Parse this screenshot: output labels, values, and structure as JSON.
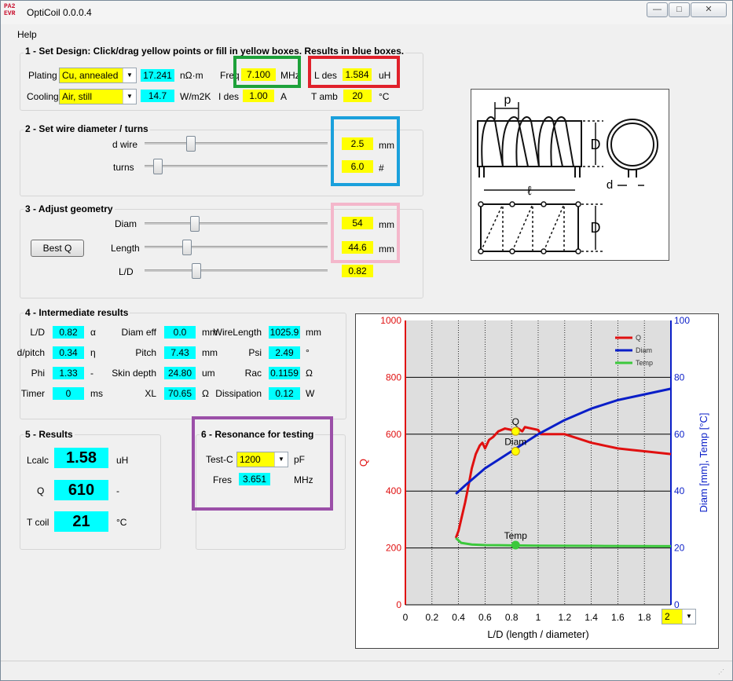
{
  "window": {
    "title": "OptiCoil 0.0.0.4",
    "logo_text": "PA2\nEVR",
    "menu": [
      "Help"
    ]
  },
  "section1": {
    "title": "1 - Set Design: Click/drag yellow points or fill in yellow boxes. Results in blue boxes.",
    "plating_label": "Plating",
    "plating_value": "Cu, annealed",
    "resistivity_value": "17.241",
    "resistivity_unit": "nΩ·m",
    "freq_label": "Freq",
    "freq_value": "7.100",
    "freq_unit": "MHz",
    "ldes_label": "L des",
    "ldes_value": "1.584",
    "ldes_unit": "uH",
    "cooling_label": "Cooling",
    "cooling_value": "Air, still",
    "htc_value": "14.7",
    "htc_unit": "W/m2K",
    "ides_label": "I des",
    "ides_value": "1.00",
    "ides_unit": "A",
    "tamb_label": "T amb",
    "tamb_value": "20",
    "tamb_unit": "°C"
  },
  "section2": {
    "title": "2 - Set wire diameter / turns",
    "dwire_label": "d wire",
    "dwire_value": "2.5",
    "dwire_unit": "mm",
    "dwire_slider": 0.25,
    "turns_label": "turns",
    "turns_value": "6.0",
    "turns_unit": "#",
    "turns_slider": 0.05
  },
  "section3": {
    "title": "3 - Adjust geometry",
    "best_q_label": "Best Q",
    "diam_label": "Diam",
    "diam_value": "54",
    "diam_unit": "mm",
    "diam_slider": 0.27,
    "length_label": "Length",
    "length_value": "44.6",
    "length_unit": "mm",
    "length_slider": 0.23,
    "ld_label": "L/D",
    "ld_value": "0.82",
    "ld_slider": 0.28
  },
  "section4": {
    "title": "4 - Intermediate results",
    "rows": [
      [
        {
          "label": "L/D",
          "value": "0.82",
          "unit": "α"
        },
        {
          "label": "Diam eff",
          "value": "0.0",
          "unit": "mm"
        },
        {
          "label": "WireLength",
          "value": "1025.9",
          "unit": "mm"
        }
      ],
      [
        {
          "label": "d/pitch",
          "value": "0.34",
          "unit": "η"
        },
        {
          "label": "Pitch",
          "value": "7.43",
          "unit": "mm"
        },
        {
          "label": "Psi",
          "value": "2.49",
          "unit": "°"
        }
      ],
      [
        {
          "label": "Phi",
          "value": "1.33",
          "unit": "-"
        },
        {
          "label": "Skin depth",
          "value": "24.80",
          "unit": "um"
        },
        {
          "label": "Rac",
          "value": "0.1159",
          "unit": "Ω"
        }
      ],
      [
        {
          "label": "Timer",
          "value": "0",
          "unit": "ms"
        },
        {
          "label": "XL",
          "value": "70.65",
          "unit": "Ω"
        },
        {
          "label": "Dissipation",
          "value": "0.12",
          "unit": "W"
        }
      ]
    ]
  },
  "section5": {
    "title": "5 - Results",
    "lcalc_label": "Lcalc",
    "lcalc_value": "1.58",
    "lcalc_unit": "uH",
    "q_label": "Q",
    "q_value": "610",
    "q_unit": "-",
    "tcoil_label": "T coil",
    "tcoil_value": "21",
    "tcoil_unit": "°C"
  },
  "section6": {
    "title": "6 - Resonance for testing",
    "testc_label": "Test-C",
    "testc_value": "1200",
    "testc_unit": "pF",
    "fres_label": "Fres",
    "fres_value": "3.651",
    "fres_unit": "MHz"
  },
  "diagram": {
    "p_label": "p",
    "D_label": "D",
    "l_label": "ℓ",
    "d_label": "d"
  },
  "highlight_colors": {
    "freq": "#1da13a",
    "ldes": "#e0202a",
    "wire": "#1aa0dc",
    "geometry": "#f4b7cb",
    "resonance": "#9b4fa8"
  },
  "chart_data": {
    "type": "line",
    "xlabel": "L/D (length / diameter)",
    "ylabel": "Q",
    "ylabel_right": "Diam [mm], Temp [°C]",
    "xlim": [
      0,
      2
    ],
    "ylim": [
      0,
      1000
    ],
    "ylim_right": [
      0,
      100
    ],
    "x_ticks": [
      "0",
      "0.2",
      "0.4",
      "0.6",
      "0.8",
      "1",
      "1.2",
      "1.4",
      "1.6",
      "1.8"
    ],
    "y_ticks": [
      "0",
      "200",
      "400",
      "600",
      "800",
      "1000"
    ],
    "y_ticks_right": [
      "0",
      "20",
      "40",
      "60",
      "80",
      "100"
    ],
    "xmax_selector": "2",
    "legend_position": "top-right",
    "grid": true,
    "series": [
      {
        "name": "Q",
        "axis": "left",
        "color": "#e01010",
        "x": [
          0.38,
          0.4,
          0.42,
          0.45,
          0.48,
          0.5,
          0.53,
          0.56,
          0.58,
          0.6,
          0.63,
          0.66,
          0.7,
          0.75,
          0.8,
          0.85,
          0.88,
          0.9,
          0.95,
          1.0,
          1.02,
          1.1,
          1.2,
          1.3,
          1.4,
          1.5,
          1.6,
          1.7,
          1.8,
          2.0
        ],
        "y": [
          235,
          260,
          300,
          360,
          430,
          480,
          530,
          560,
          570,
          550,
          580,
          590,
          610,
          620,
          615,
          620,
          610,
          625,
          620,
          615,
          600,
          600,
          600,
          585,
          570,
          560,
          550,
          545,
          540,
          530
        ]
      },
      {
        "name": "Diam",
        "axis": "right",
        "color": "#0a1ec8",
        "x": [
          0.38,
          0.45,
          0.5,
          0.6,
          0.7,
          0.8,
          0.9,
          1.0,
          1.2,
          1.4,
          1.6,
          1.8,
          2.0
        ],
        "y": [
          39,
          42,
          44,
          48,
          51,
          54,
          57,
          60,
          65,
          69,
          72,
          74,
          76
        ]
      },
      {
        "name": "Temp",
        "axis": "right",
        "color": "#3cc83c",
        "x": [
          0.38,
          0.42,
          0.5,
          0.6,
          0.8,
          1.0,
          1.5,
          2.0
        ],
        "y": [
          23.5,
          21.8,
          21.2,
          21.0,
          20.9,
          20.8,
          20.7,
          20.6
        ]
      }
    ],
    "markers": [
      {
        "label": "Q",
        "x": 0.83,
        "axis": "left",
        "y": 610
      },
      {
        "label": "Diam",
        "x": 0.83,
        "axis": "right",
        "y": 54
      },
      {
        "label": "Temp",
        "x": 0.83,
        "axis": "right",
        "y": 21
      }
    ]
  }
}
